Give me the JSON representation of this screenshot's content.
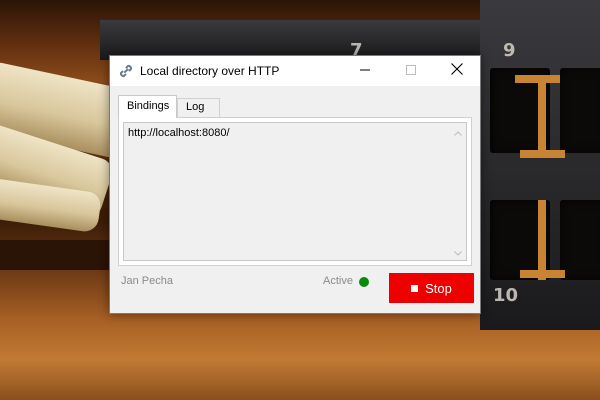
{
  "background": {
    "port_numbers": [
      "7",
      "9",
      "10"
    ]
  },
  "window": {
    "title": "Local directory over HTTP",
    "title_icon": "link-icon",
    "controls": {
      "minimize": "minimize-icon",
      "maximize": "maximize-icon",
      "close": "close-icon"
    }
  },
  "tabs": [
    {
      "label": "Bindings",
      "active": true
    },
    {
      "label": "Log",
      "active": false
    }
  ],
  "bindings": {
    "text": "http://localhost:8080/"
  },
  "footer": {
    "author": "Jan Pecha",
    "status_text": "Active",
    "status_color": "#0a8a0a",
    "stop_label": "Stop",
    "stop_color": "#ee0000"
  }
}
